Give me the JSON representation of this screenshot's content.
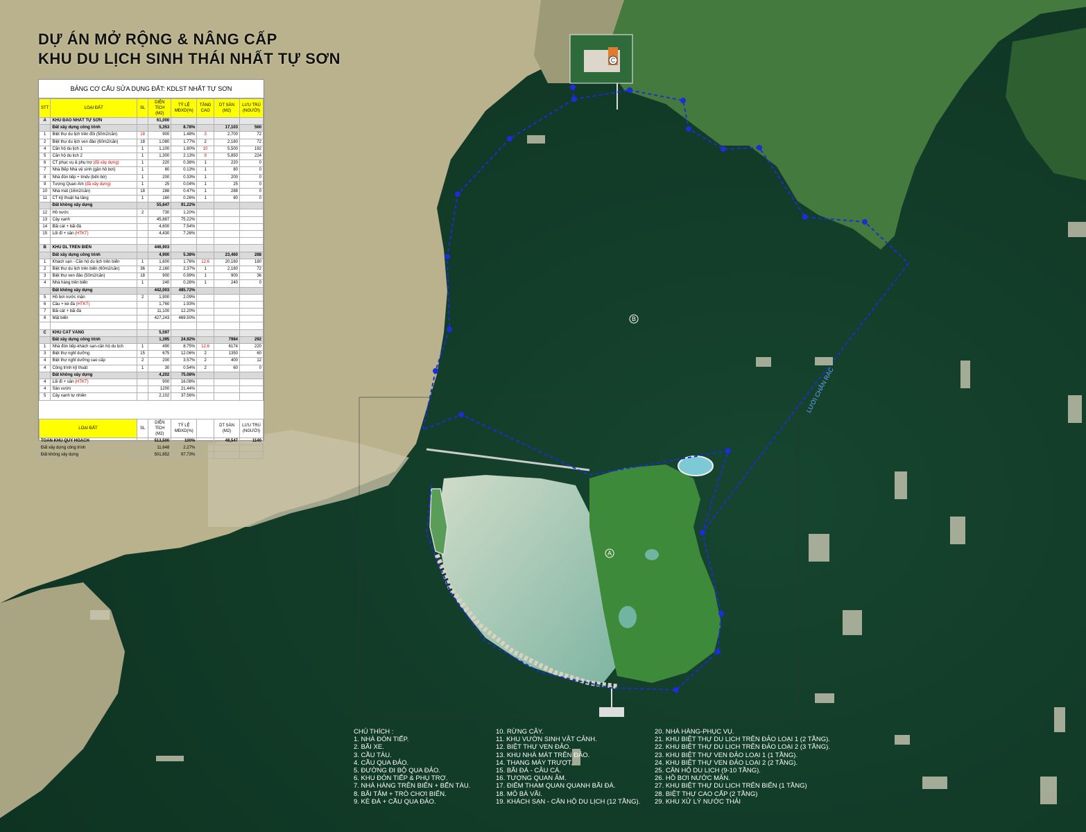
{
  "title": {
    "line1": "DỰ ÁN MỞ RỘNG & NÂNG CẤP",
    "line2": "KHU DU LỊCH SINH THÁI NHẤT TỰ SƠN"
  },
  "table": {
    "caption": "BẢNG CƠ CẤU SỬA DỤNG ĐẤT: KDLST NHẤT TỰ SƠN",
    "headers": [
      "STT",
      "LOẠI ĐẤT",
      "SL",
      "DIỆN TÍCH (M2)",
      "TỶ LỆ MĐXD(%)",
      "TẦNG CAO",
      "DT SÀN (M2)",
      "LƯU TRÚ (NGƯỜI)"
    ],
    "rows": [
      {
        "stt": "A",
        "name": "KHU ĐẢO NHẤT TỰ SƠN",
        "sl": "",
        "area": "61,000",
        "ratio": "",
        "floors": "",
        "floor_area": "",
        "guests": "",
        "style": "sec"
      },
      {
        "stt": "",
        "name": "Đất xây dựng công trình",
        "sl": "",
        "area": "5,353",
        "ratio": "8.78%",
        "floors": "",
        "floor_area": "17,103",
        "guests": "560",
        "style": "sub"
      },
      {
        "stt": "1",
        "name": "Biệt thự du lịch trên đồi (50m2/căn)",
        "sl": "18",
        "area": "900",
        "ratio": "1.48%",
        "floors": "3",
        "floor_area": "2,700",
        "guests": "72",
        "style": ""
      },
      {
        "stt": "2",
        "name": "Biệt thự du lịch ven đảo (60m2/căn)",
        "sl": "18",
        "area": "1,080",
        "ratio": "1.77%",
        "floors": "2",
        "floor_area": "2,160",
        "guests": "72",
        "style": ""
      },
      {
        "stt": "4",
        "name": "Căn hộ du lịch 1",
        "sl": "1",
        "area": "1,100",
        "ratio": "1.80%",
        "floors": "10",
        "floor_area": "5,500",
        "guests": "192",
        "style": ""
      },
      {
        "stt": "5",
        "name": "Căn hộ du lịch 2",
        "sl": "1",
        "area": "1,300",
        "ratio": "2.13%",
        "floors": "9",
        "floor_area": "5,850",
        "guests": "224",
        "style": ""
      },
      {
        "stt": "6",
        "name": "CT phục vụ & phụ trợ",
        "note": "(đã xây dựng)",
        "sl": "1",
        "area": "220",
        "ratio": "0.36%",
        "floors": "1",
        "floor_area": "220",
        "guests": "0",
        "style": ""
      },
      {
        "stt": "7",
        "name": "Nhà Bếp Nhà vệ sinh (gần hồ bơi)",
        "sl": "1",
        "area": "80",
        "ratio": "0.13%",
        "floors": "1",
        "floor_area": "80",
        "guests": "0",
        "style": ""
      },
      {
        "stt": "8",
        "name": "Nhà đón tiếp + tmdv (bến bờ)",
        "sl": "1",
        "area": "200",
        "ratio": "0.33%",
        "floors": "1",
        "floor_area": "200",
        "guests": "0",
        "style": ""
      },
      {
        "stt": "9",
        "name": "Tượng Quan Âm",
        "note": "(đã xây dựng)",
        "sl": "1",
        "area": "25",
        "ratio": "0.04%",
        "floors": "1",
        "floor_area": "25",
        "guests": "0",
        "style": ""
      },
      {
        "stt": "10",
        "name": "Nhà mát (16m2/căn)",
        "sl": "18",
        "area": "288",
        "ratio": "0.47%",
        "floors": "1",
        "floor_area": "288",
        "guests": "0",
        "style": ""
      },
      {
        "stt": "11",
        "name": "CT kỹ thuật hạ tầng",
        "sl": "1",
        "area": "160",
        "ratio": "0.26%",
        "floors": "1",
        "floor_area": "80",
        "guests": "0",
        "style": ""
      },
      {
        "stt": "",
        "name": "Đất không xây dựng",
        "sl": "",
        "area": "55,647",
        "ratio": "91.22%",
        "floors": "",
        "floor_area": "",
        "guests": "",
        "style": "sub"
      },
      {
        "stt": "12",
        "name": "Hồ nước",
        "sl": "2",
        "area": "730",
        "ratio": "1.20%",
        "floors": "",
        "floor_area": "",
        "guests": "",
        "style": ""
      },
      {
        "stt": "13",
        "name": "Cây xanh",
        "sl": "",
        "area": "45,887",
        "ratio": "75.22%",
        "floors": "",
        "floor_area": "",
        "guests": "",
        "style": ""
      },
      {
        "stt": "14",
        "name": "Bãi cát + bãi đá",
        "sl": "",
        "area": "4,600",
        "ratio": "7.54%",
        "floors": "",
        "floor_area": "",
        "guests": "",
        "style": ""
      },
      {
        "stt": "15",
        "name": "Lối đi + sân",
        "note": "(HTKT)",
        "sl": "",
        "area": "4,430",
        "ratio": "7.26%",
        "floors": "",
        "floor_area": "",
        "guests": "",
        "style": ""
      },
      {
        "stt": "",
        "name": "",
        "sl": "",
        "area": "",
        "ratio": "",
        "floors": "",
        "floor_area": "",
        "guests": "",
        "style": ""
      },
      {
        "stt": "B",
        "name": "KHU DL TRÊN BIỂN",
        "sl": "",
        "area": "446,903",
        "ratio": "",
        "floors": "",
        "floor_area": "",
        "guests": "",
        "style": "sec"
      },
      {
        "stt": "",
        "name": "Đất xây dựng công trình",
        "sl": "",
        "area": "4,900",
        "ratio": "5.38%",
        "floors": "",
        "floor_area": "23,460",
        "guests": "288",
        "style": "sub"
      },
      {
        "stt": "1",
        "name": "Khách sạn - Căn hộ du lịch trên biển",
        "sl": "1",
        "area": "1,600",
        "ratio": "1.76%",
        "floors": "12.6",
        "floor_area": "20,160",
        "guests": "180",
        "style": ""
      },
      {
        "stt": "2",
        "name": "Biệt thự du lịch trên biển (60m2/căn)",
        "sl": "36",
        "area": "2,160",
        "ratio": "2.37%",
        "floors": "1",
        "floor_area": "2,160",
        "guests": "72",
        "style": ""
      },
      {
        "stt": "3",
        "name": "Biệt thự ven đảo (50m2/căn)",
        "sl": "18",
        "area": "900",
        "ratio": "0.99%",
        "floors": "1",
        "floor_area": "900",
        "guests": "36",
        "style": ""
      },
      {
        "stt": "4",
        "name": "Nhà hàng trên biển",
        "sl": "1",
        "area": "240",
        "ratio": "0.26%",
        "floors": "1",
        "floor_area": "240",
        "guests": "0",
        "style": ""
      },
      {
        "stt": "",
        "name": "Đất không xây dựng",
        "sl": "",
        "area": "442,003",
        "ratio": "485.72%",
        "floors": "",
        "floor_area": "",
        "guests": "",
        "style": "sub"
      },
      {
        "stt": "5",
        "name": "Hồ bơi nước mặn",
        "sl": "2",
        "area": "1,900",
        "ratio": "2.09%",
        "floors": "",
        "floor_area": "",
        "guests": "",
        "style": ""
      },
      {
        "stt": "6",
        "name": "Cầu + kè đá",
        "note": "(HTKT)",
        "sl": "",
        "area": "1,760",
        "ratio": "1.93%",
        "floors": "",
        "floor_area": "",
        "guests": "",
        "style": ""
      },
      {
        "stt": "7",
        "name": "Bãi cát + bãi đá",
        "sl": "",
        "area": "11,100",
        "ratio": "12.20%",
        "floors": "",
        "floor_area": "",
        "guests": "",
        "style": ""
      },
      {
        "stt": "8",
        "name": "Mặt biển",
        "sl": "",
        "area": "427,243",
        "ratio": "469.50%",
        "floors": "",
        "floor_area": "",
        "guests": "",
        "style": ""
      },
      {
        "stt": "",
        "name": "",
        "sl": "",
        "area": "",
        "ratio": "",
        "floors": "",
        "floor_area": "",
        "guests": "",
        "style": ""
      },
      {
        "stt": "C",
        "name": "KHU CÁT VÀNG",
        "sl": "",
        "area": "5,597",
        "ratio": "",
        "floors": "",
        "floor_area": "",
        "guests": "",
        "style": "sec"
      },
      {
        "stt": "",
        "name": "Đất xây dựng công trình",
        "sl": "",
        "area": "1,395",
        "ratio": "24.92%",
        "floors": "",
        "floor_area": "7984",
        "guests": "292",
        "style": "sub"
      },
      {
        "stt": "1",
        "name": "Nhà đón tiếp-khách sạn-căn hộ du lịch",
        "sl": "1",
        "area": "490",
        "ratio": "8.75%",
        "floors": "12.6",
        "floor_area": "6174",
        "guests": "220",
        "style": ""
      },
      {
        "stt": "3",
        "name": "Biệt thự nghỉ dưỡng",
        "sl": "15",
        "area": "675",
        "ratio": "12.06%",
        "floors": "2",
        "floor_area": "1350",
        "guests": "60",
        "style": ""
      },
      {
        "stt": "4",
        "name": "Biệt thự nghỉ dưỡng cao cấp",
        "sl": "2",
        "area": "200",
        "ratio": "3.57%",
        "floors": "2",
        "floor_area": "400",
        "guests": "12",
        "style": ""
      },
      {
        "stt": "4",
        "name": "Công trình kỹ thuật",
        "sl": "1",
        "area": "30",
        "ratio": "0.54%",
        "floors": "2",
        "floor_area": "60",
        "guests": "0",
        "style": ""
      },
      {
        "stt": "",
        "name": "Đất không xây dựng",
        "sl": "",
        "area": "4,202",
        "ratio": "75.08%",
        "floors": "",
        "floor_area": "",
        "guests": "",
        "style": "sub"
      },
      {
        "stt": "4",
        "name": "Lối đi + sân",
        "note": "(HTKT)",
        "sl": "",
        "area": "900",
        "ratio": "16.08%",
        "floors": "",
        "floor_area": "",
        "guests": "",
        "style": ""
      },
      {
        "stt": "4",
        "name": "Sân vườn",
        "sl": "",
        "area": "1200",
        "ratio": "21.44%",
        "floors": "",
        "floor_area": "",
        "guests": "",
        "style": ""
      },
      {
        "stt": "5",
        "name": "Cây xanh tự nhiên",
        "sl": "",
        "area": "2,102",
        "ratio": "37.56%",
        "floors": "",
        "floor_area": "",
        "guests": "",
        "style": ""
      }
    ],
    "summary_headers": [
      "LOẠI ĐẤT",
      "SL",
      "DIỆN TÍCH (M2)",
      "TỶ LỆ MĐXD(%)",
      "DT SÀN (M2)",
      "LƯU TRÚ (NGƯỜI)"
    ],
    "summary_rows": [
      {
        "name": "TOÀN KHU QUY HOẠCH",
        "sl": "",
        "area": "513,500",
        "ratio": "100%",
        "floor_area": "48,547",
        "guests": "1140",
        "style": "total"
      },
      {
        "name": "Đất xây dựng công trình",
        "sl": "",
        "area": "11,648",
        "ratio": "2.27%",
        "floor_area": "",
        "guests": "",
        "style": ""
      },
      {
        "name": "Đất không xây dựng",
        "sl": "",
        "area": "501,852",
        "ratio": "97.73%",
        "floor_area": "",
        "guests": "",
        "style": ""
      }
    ]
  },
  "legend": {
    "col1": [
      "CHÚ THÍCH :",
      "1. NHÀ ĐÓN TIẾP.",
      "2. BÃI XE.",
      "3. CẦU TÀU.",
      "4. CẦU QUA ĐẢO.",
      "5. ĐƯỜNG ĐI BỘ QUA ĐẢO.",
      "6. KHU ĐÓN TIẾP & PHỤ TRỢ.",
      "7. NHÀ HÀNG TRÊN BIỂN + BẾN TÀU.",
      "8. BÃI TẮM + TRÒ CHƠI BIỂN.",
      "9. KÈ ĐÁ + CẦU QUA ĐẢO."
    ],
    "col2": [
      "10. RỪNG CÂY.",
      "11. KHU VƯỜN SINH VẬT CẢNH.",
      "12. BIỆT THỰ VEN ĐẢO.",
      "13. KHU NHÀ MÁT TRÊN ĐẢO.",
      "14. THANG MÁY TRƯỢT.",
      "15. BÃI ĐÁ - CÂU CÁ.",
      "16. TƯỢNG QUAN ÂM.",
      "17. ĐIỂM THAM QUAN QUANH BÃI ĐÁ.",
      "18. MỎ BÀ VÃI.",
      "19. KHÁCH SẠN - CĂN HỘ DU LỊCH (12 TẦNG)."
    ],
    "col3": [
      "20. NHÀ HÀNG-PHỤC VỤ.",
      "21. KHU BIỆT THỰ DU LỊCH TRÊN ĐẢO LOẠI 1 (2 TẦNG).",
      "22. KHU BIỆT THỰ DU LỊCH TRÊN ĐẢO LOẠI 2 (3 TẦNG).",
      "23. KHU BIỆT THỰ VEN ĐẢO LOẠI 1 (1 TẦNG).",
      "24. KHU BIỆT THỰ VEN ĐẢO LOẠI 2 (2 TẦNG).",
      "25. CĂN HỘ DU LỊCH (9-10 TẦNG).",
      "26. HỒ BƠI NƯỚC MẶN.",
      "27. KHU BIỆT THỰ DU LỊCH TRÊN BIỂN (1 TẦNG)",
      "28. BIỆT THỰ CAO CẤP (2 TẦNG)",
      "29. KHU XỬ LÝ NƯỚC THẢI"
    ]
  },
  "map": {
    "zone_labels": [
      "A",
      "B",
      "C"
    ],
    "net_label": "LƯỚI CHẮN RÁC",
    "colors": {
      "sea": "#123d2a",
      "forest": "#3f7a3a",
      "land": "#b7b08a",
      "lagoon": "#9fc6b4",
      "boundary": "#1a2fd6"
    }
  }
}
